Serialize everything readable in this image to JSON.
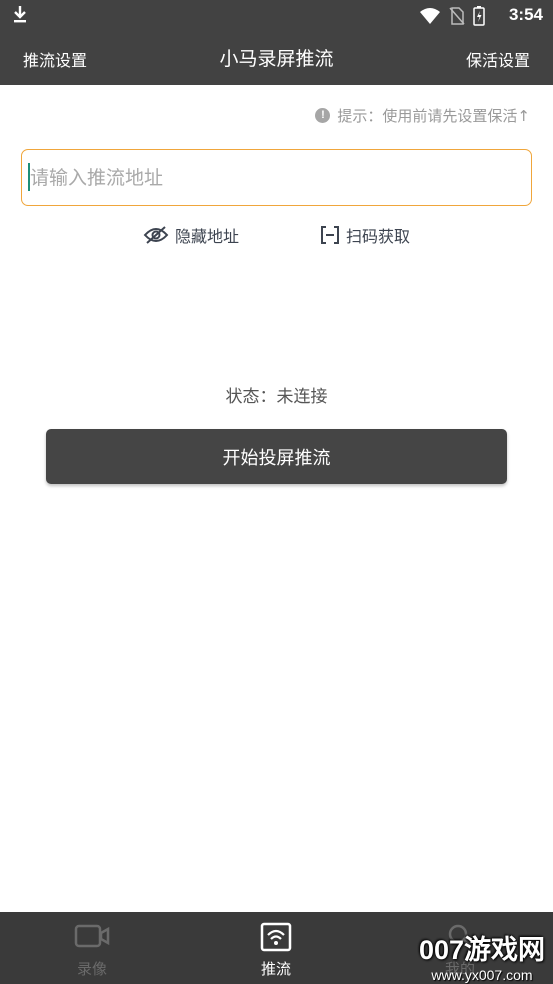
{
  "status_bar": {
    "time": "3:54",
    "icons": [
      "download-icon",
      "wifi-icon",
      "no-sim-icon",
      "battery-icon"
    ]
  },
  "app_bar": {
    "left_label": "推流设置",
    "title": "小马录屏推流",
    "right_label": "保活设置"
  },
  "hint": {
    "icon": "info-icon",
    "text": "提示：使用前请先设置保活↑"
  },
  "url_input": {
    "value": "",
    "placeholder": "请输入推流地址"
  },
  "actions": {
    "hide_label": "隐藏地址",
    "scan_label": "扫码获取"
  },
  "status": {
    "label": "状态：",
    "value": "未连接"
  },
  "start_button_label": "开始投屏推流",
  "bottom_nav": {
    "tabs": [
      {
        "label": "录像",
        "icon": "video-camera-icon",
        "active": false
      },
      {
        "label": "推流",
        "icon": "wifi-stream-icon",
        "active": true
      },
      {
        "label": "我的",
        "icon": "search-icon",
        "active": false
      }
    ]
  },
  "watermark": {
    "brand": "007游戏网",
    "url": "www.yx007.com"
  },
  "colors": {
    "bar_background": "#424242",
    "input_border": "#f0a63b",
    "button_background": "#454545",
    "nav_background": "#3a3a3a",
    "inactive_tab": "#6a6a6a"
  }
}
